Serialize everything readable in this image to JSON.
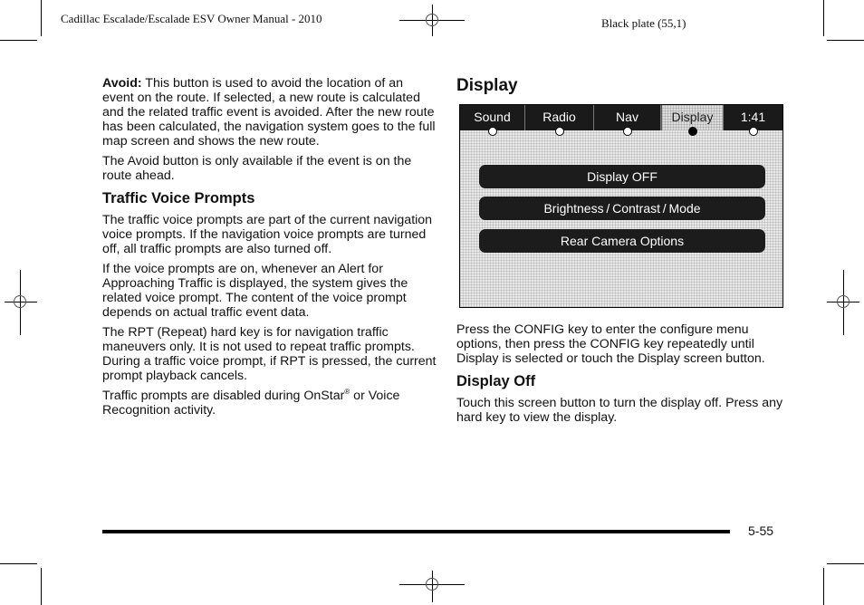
{
  "header": {
    "manual_title": "Cadillac Escalade/Escalade ESV Owner Manual - 2010",
    "plate": "Black plate (55,1)"
  },
  "left_column": {
    "avoid_label": "Avoid:",
    "avoid_text": " This button is used to avoid the location of an event on the route. If selected, a new route is calculated and the related traffic event is avoided. After the new route has been calculated, the navigation system goes to the full map screen and shows the new route.",
    "avoid_note": "The Avoid button is only available if the event is on the route ahead.",
    "traffic_heading": "Traffic Voice Prompts",
    "traffic_p1": "The traffic voice prompts are part of the current navigation voice prompts. If the navigation voice prompts are turned off, all traffic prompts are also turned off.",
    "traffic_p2": "If the voice prompts are on, whenever an Alert for Approaching Traffic is displayed, the system gives the related voice prompt. The content of the voice prompt depends on actual traffic event data.",
    "traffic_p3": "The RPT (Repeat) hard key is for navigation traffic maneuvers only. It is not used to repeat traffic prompts. During a traffic voice prompt, if RPT is pressed, the current prompt playback cancels.",
    "traffic_p4_a": "Traffic prompts are disabled during OnStar",
    "traffic_p4_sup": "®",
    "traffic_p4_b": " or Voice Recognition activity."
  },
  "right_column": {
    "display_heading": "Display",
    "screen": {
      "tabs": [
        {
          "label": "Sound",
          "active": false
        },
        {
          "label": "Radio",
          "active": false
        },
        {
          "label": "Nav",
          "active": false
        },
        {
          "label": "Display",
          "active": true
        },
        {
          "label": "1:41",
          "active": false
        }
      ],
      "buttons": [
        "Display OFF",
        "Brightness / Contrast / Mode",
        "Rear Camera Options"
      ]
    },
    "config_text": "Press the CONFIG key to enter the configure menu options, then press the CONFIG key repeatedly until Display is selected or touch the Display screen button.",
    "display_off_heading": "Display Off",
    "display_off_text": "Touch this screen button to turn the display off. Press any hard key to view the display."
  },
  "footer": {
    "page_number": "5-55"
  }
}
